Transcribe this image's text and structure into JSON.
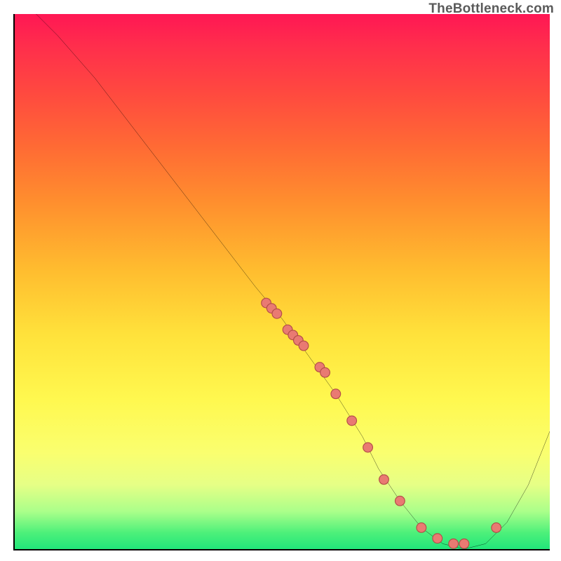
{
  "watermark": "TheBottleneck.com",
  "chart_data": {
    "type": "line",
    "title": "",
    "xlabel": "",
    "ylabel": "",
    "xlim": [
      0,
      100
    ],
    "ylim": [
      0,
      100
    ],
    "grid": false,
    "legend": false,
    "series": [
      {
        "name": "curve",
        "x": [
          4,
          8,
          15,
          25,
          35,
          45,
          50,
          55,
          60,
          65,
          68,
          72,
          76,
          80,
          84,
          88,
          92,
          96,
          100
        ],
        "y": [
          100,
          96,
          88,
          75,
          62,
          49,
          43,
          36,
          29,
          21,
          15,
          9,
          4,
          1,
          0,
          1,
          5,
          12,
          22
        ]
      },
      {
        "name": "markers",
        "x": [
          47,
          48,
          49,
          51,
          52,
          53,
          54,
          57,
          58,
          60,
          63,
          66,
          69,
          72,
          76,
          79,
          82,
          84,
          90
        ],
        "y": [
          46,
          45,
          44,
          41,
          40,
          39,
          38,
          34,
          33,
          29,
          24,
          19,
          13,
          9,
          4,
          2,
          1,
          1,
          4
        ]
      }
    ],
    "colors": {
      "curve": "#000000",
      "marker_fill": "#e97a72",
      "marker_stroke": "#b24d47"
    }
  }
}
